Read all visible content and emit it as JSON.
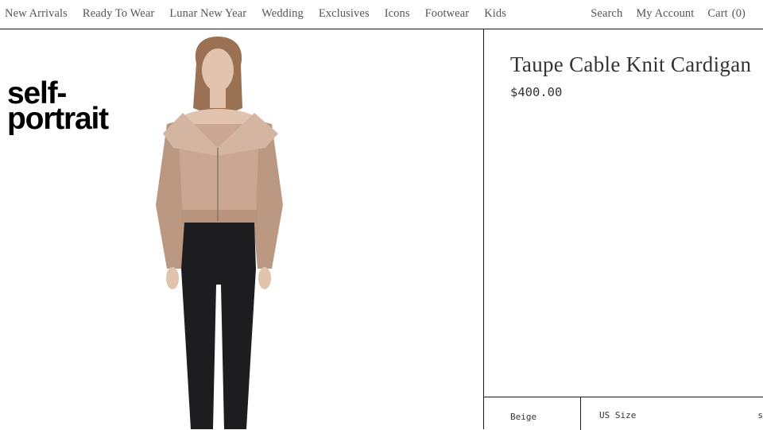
{
  "nav": {
    "left_items": [
      "New Arrivals",
      "Ready To Wear",
      "Lunar New Year",
      "Wedding",
      "Exclusives",
      "Icons",
      "Footwear",
      "Kids"
    ],
    "search": "Search",
    "account": "My Account",
    "cart_label": "Cart",
    "cart_count": "(0)"
  },
  "brand": {
    "line1": "self-",
    "line2": "portrait"
  },
  "product": {
    "title": "Taupe Cable Knit Cardigan",
    "price": "$400.00",
    "color": "Beige",
    "size_label": "US Size",
    "edge_glyph": "s"
  },
  "colors": {
    "knit": "#c9a793",
    "leggings": "#1d1d1f",
    "hair": "#9a7253",
    "skin": "#e2c3ad",
    "border": "#1a1a1a"
  }
}
